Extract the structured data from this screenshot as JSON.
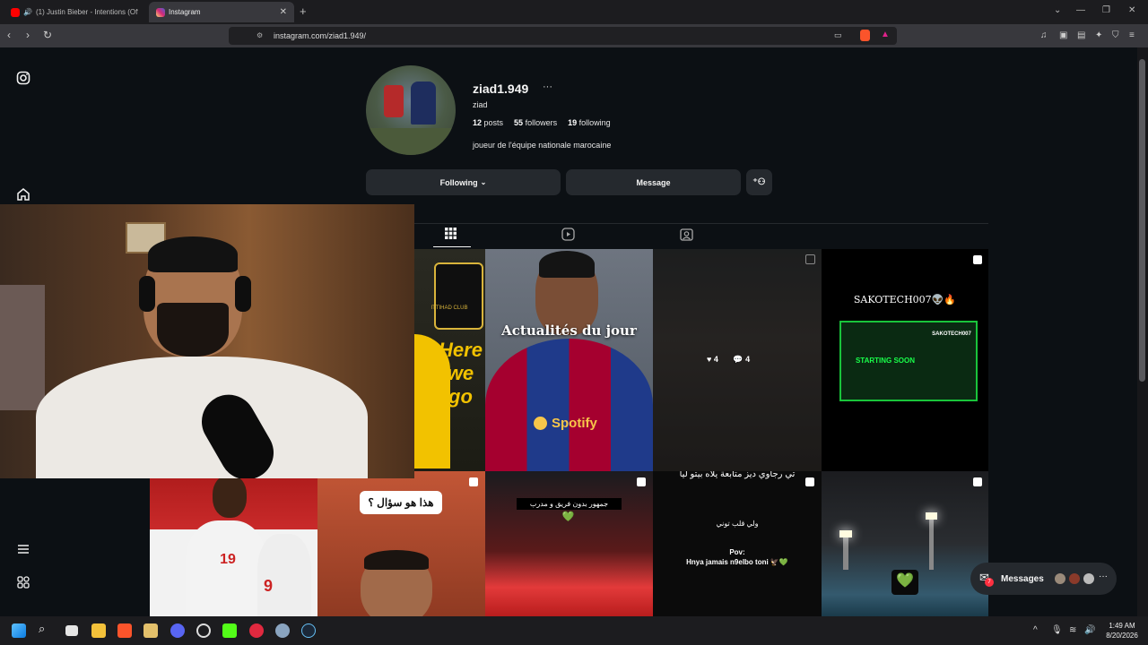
{
  "browser": {
    "tabs": [
      {
        "title": "(1) Justin Bieber - Intentions (Offi"
      },
      {
        "title": "Instagram"
      }
    ],
    "url": "instagram.com/ziad1.949/",
    "colors": {
      "youtube": "#ff0000",
      "instagram": "#d62976",
      "brave": "#fb542b"
    }
  },
  "profile": {
    "username": "ziad1.949",
    "more": "···",
    "full_name": "ziad",
    "posts_count": "12",
    "posts_label": "posts",
    "followers_count": "55",
    "followers_label": "followers",
    "following_count": "19",
    "following_label": "following",
    "bio": "joueur de l'équipe nationale marocaine",
    "following_button": "Following",
    "message_button": "Message"
  },
  "posts": {
    "p1": {
      "text1": "Here",
      "text2": "we",
      "text3": "go",
      "badge": "ITTIHAD CLUB"
    },
    "p2": {
      "title": "Actualités du jour",
      "sponsor": "Spotify"
    },
    "p3": {
      "likes": "4",
      "comments": "4"
    },
    "p4": {
      "title": "SAKOTECH007",
      "emoji": "👽🔥",
      "starting": "STARTING SOON",
      "tag": "SAKOTECH007"
    },
    "p5": {
      "number1": "19",
      "number2": "9"
    },
    "p6": {
      "caption": "هذا هو سؤال ؟"
    },
    "p7": {
      "caption": "جمهور بدون فريق و مدرب",
      "heart": "💚"
    },
    "p8": {
      "top": "تي رجاوي ديز متابعة يلاه بيتو ليا",
      "mid": "ولي قلب توني",
      "pov": "Pov:",
      "line": "Hnya jamais n9elbo toni 🦅💚"
    },
    "p9": {
      "heart": "💚"
    }
  },
  "messages": {
    "label": "Messages",
    "badge": "7"
  },
  "taskbar": {
    "time": "1:49 AM",
    "date": "8/20/2026"
  }
}
